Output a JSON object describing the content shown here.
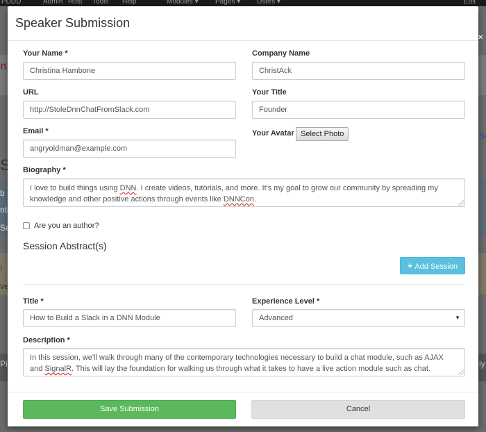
{
  "background": {
    "topbar_items": [
      "PDDD",
      "Admin",
      "Host",
      "Tools",
      "Help",
      "Modules ▾",
      "Pages ▾",
      "Users ▾",
      "Edit"
    ],
    "fragments": [
      "n",
      "Sp",
      "b",
      "nte",
      "Se",
      "!",
      "ve",
      "Sessio",
      "ly",
      "Pi"
    ]
  },
  "modal": {
    "title": "Speaker Submission",
    "fields": {
      "your_name": {
        "label": "Your Name",
        "required": "*",
        "value": "Christina Hambone"
      },
      "company_name": {
        "label": "Company Name",
        "value": "ChristAck"
      },
      "url": {
        "label": "URL",
        "value": "http://StoleDnnChatFromSlack.com"
      },
      "your_title": {
        "label": "Your Title",
        "value": "Founder"
      },
      "email": {
        "label": "Email",
        "required": "*",
        "value": "angryoldman@example.com"
      },
      "your_avatar": {
        "label": "Your Avatar",
        "button": "Select Photo"
      },
      "biography": {
        "label": "Biography",
        "required": "*",
        "value_parts": [
          "I love to build things using ",
          "DNN",
          ".  I create videos, tutorials, and more.  It's my goal to grow our community by spreading my knowledge and other positive actions through events like ",
          "DNNCon",
          "."
        ]
      },
      "author_checkbox": {
        "label": "Are you an author?",
        "checked": false
      }
    },
    "session": {
      "section_title": "Session Abstract(s)",
      "add_button": "Add Session",
      "title": {
        "label": "Title",
        "required": "*",
        "value": "How to Build a Slack in a DNN Module"
      },
      "experience": {
        "label": "Experience Level",
        "required": "*",
        "value": "Advanced"
      },
      "description": {
        "label": "Description",
        "required": "*",
        "value_parts": [
          "In this session, we'll walk through many of the contemporary technologies necessary to build a chat module, such as AJAX and ",
          "SignalR",
          ".  This will lay the foundation for walking us through what it takes to have a live action module such as chat."
        ]
      }
    },
    "footer": {
      "save": "Save Submission",
      "cancel": "Cancel"
    }
  },
  "colors": {
    "save": "#5cb85c",
    "add_session": "#5bc0de",
    "cancel": "#e0e0e0"
  }
}
